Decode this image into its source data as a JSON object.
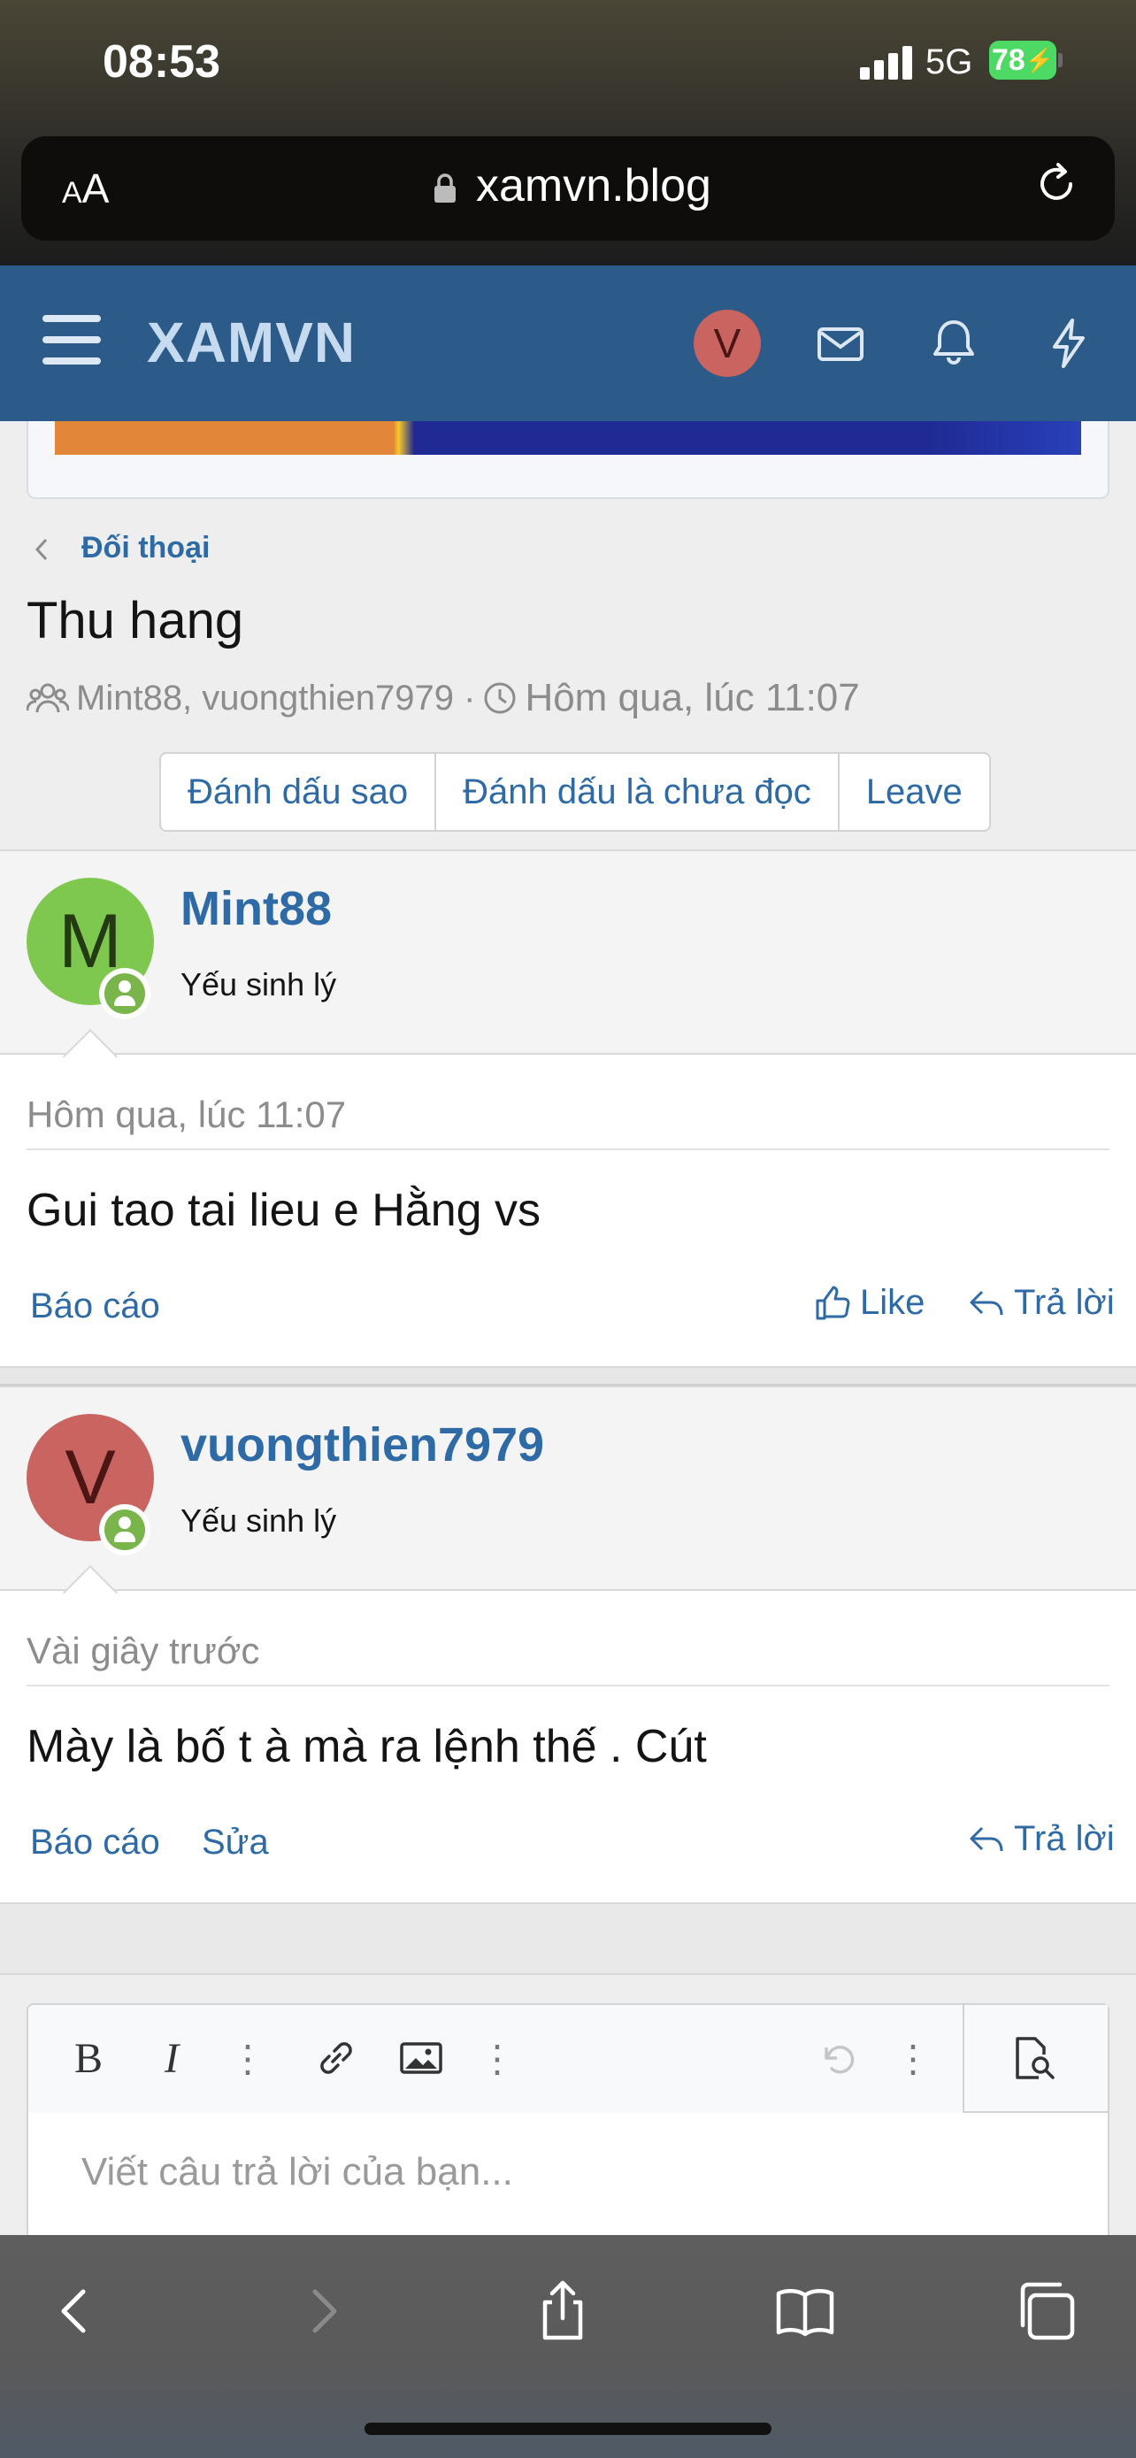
{
  "status_bar": {
    "time": "08:53",
    "network": "5G",
    "battery": "78"
  },
  "browser": {
    "text_size_label_small": "A",
    "text_size_label_large": "A",
    "url": "xamvn.blog"
  },
  "site": {
    "logo": "XAMVN",
    "header_avatar_letter": "V",
    "brand_color": "#2d5b89"
  },
  "breadcrumb": {
    "label": "Đối thoại"
  },
  "conversation": {
    "title": "Thu hang",
    "participants": "Mint88, vuongthien7979 ·",
    "started": "Hôm qua, lúc 11:07",
    "buttons": {
      "star": "Đánh dấu sao",
      "mark_unread": "Đánh dấu là chưa đọc",
      "leave": "Leave"
    }
  },
  "messages": [
    {
      "avatar_letter": "M",
      "avatar_color": "#7ec850",
      "username": "Mint88",
      "user_title": "Yếu sinh lý",
      "time": "Hôm qua, lúc 11:07",
      "text": "Gui tao tai lieu e Hằng vs",
      "actions": {
        "report": "Báo cáo",
        "like": "Like",
        "reply": "Trả lời"
      }
    },
    {
      "avatar_letter": "V",
      "avatar_color": "#c96460",
      "username": "vuongthien7979",
      "user_title": "Yếu sinh lý",
      "time": "Vài giây trước",
      "text": "Mày là bố t à mà ra lệnh thế . Cút",
      "actions": {
        "report": "Báo cáo",
        "edit": "Sửa",
        "reply": "Trả lời"
      }
    }
  ],
  "editor": {
    "placeholder": "Viết câu trả lời của bạn..."
  }
}
